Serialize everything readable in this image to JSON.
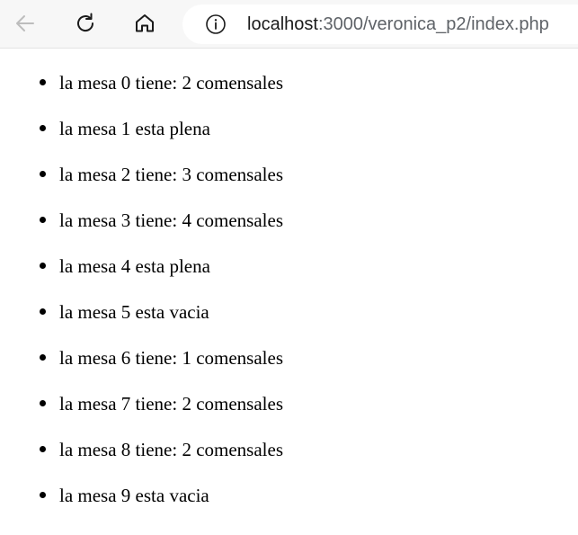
{
  "browser": {
    "url_host": "localhost",
    "url_rest": ":3000/veronica_p2/index.php"
  },
  "page": {
    "items": [
      "la mesa 0 tiene: 2 comensales",
      "la mesa 1 esta plena",
      "la mesa 2 tiene: 3 comensales",
      "la mesa 3 tiene: 4 comensales",
      "la mesa 4 esta plena",
      "la mesa 5 esta vacia",
      "la mesa 6 tiene: 1 comensales",
      "la mesa 7 tiene: 2 comensales",
      "la mesa 8 tiene: 2 comensales",
      "la mesa 9 esta vacia"
    ]
  }
}
